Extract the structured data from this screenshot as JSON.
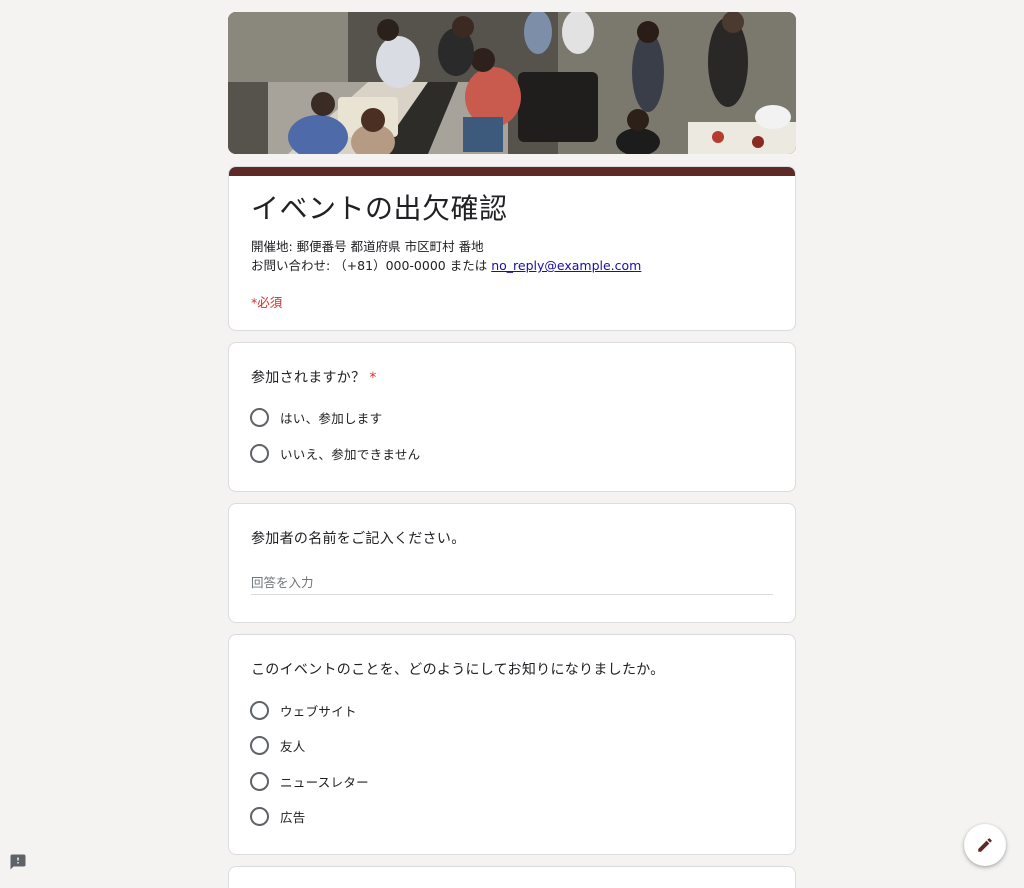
{
  "form": {
    "title": "イベントの出欠確認",
    "description_line1": "開催地: 郵便番号 都道府県 市区町村 番地",
    "description_line2_prefix": "お問い合わせ: （+81）000-0000 または ",
    "contact_email": "no_reply@example.com",
    "required_note": "*必須",
    "accent_color": "#5d2a28"
  },
  "questions": {
    "attend": {
      "label": "参加されますか？",
      "required_mark": "*",
      "options": [
        "はい、参加します",
        "いいえ、参加できません"
      ]
    },
    "name": {
      "label": "参加者の名前をご記入ください。",
      "placeholder": "回答を入力"
    },
    "source": {
      "label": "このイベントのことを、どのようにしてお知りになりましたか。",
      "options": [
        "ウェブサイト",
        "友人",
        "ニュースレター",
        "広告"
      ]
    }
  },
  "icons": {
    "fab": "pencil-icon",
    "feedback": "feedback-icon"
  }
}
